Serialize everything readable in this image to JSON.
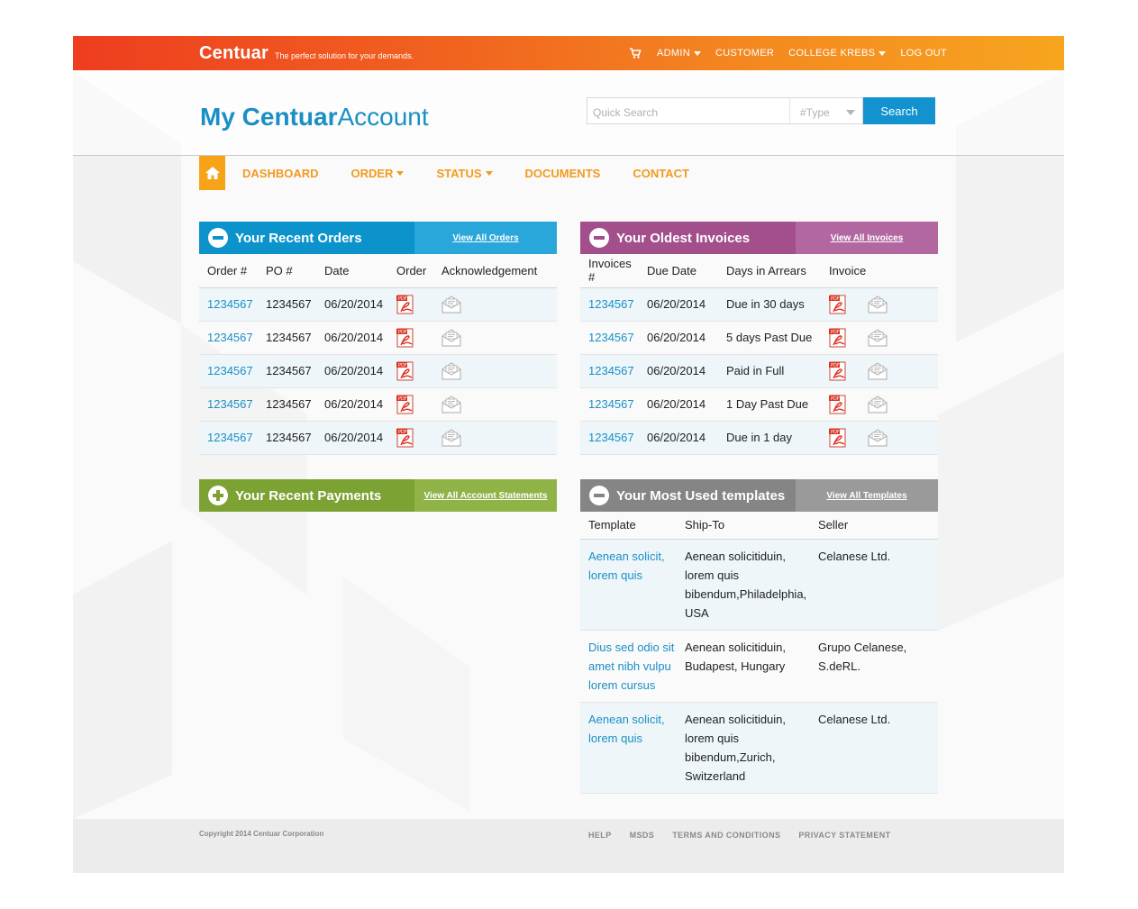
{
  "topbar": {
    "brand": "Centuar",
    "tagline": "The perfect solution for your demands.",
    "cart_icon": "cart-icon",
    "links": [
      "ADMIN",
      "CUSTOMER",
      "COLLEGE KREBS",
      "LOG OUT"
    ],
    "gradient_colors": [
      "#ee3d1f",
      "#f7a51f"
    ]
  },
  "header": {
    "title_bold": "My Centuar",
    "title_light": "Account",
    "search_placeholder": "Quick Search",
    "type_placeholder": "#Type",
    "search_button": "Search"
  },
  "nav": {
    "home_icon": "home-icon",
    "items": [
      "DASHBOARD",
      "ORDER",
      "STATUS",
      "DOCUMENTS",
      "CONTACT"
    ],
    "accent": "#f29a1e"
  },
  "orders": {
    "title": "Your Recent Orders",
    "link": "View All Orders",
    "headers": [
      "Order #",
      "PO #",
      "Date",
      "Order",
      "Acknowledgement"
    ],
    "rows": [
      {
        "order": "1234567",
        "po": "1234567",
        "date": "06/20/2014"
      },
      {
        "order": "1234567",
        "po": "1234567",
        "date": "06/20/2014"
      },
      {
        "order": "1234567",
        "po": "1234567",
        "date": "06/20/2014"
      },
      {
        "order": "1234567",
        "po": "1234567",
        "date": "06/20/2014"
      },
      {
        "order": "1234567",
        "po": "1234567",
        "date": "06/20/2014"
      }
    ]
  },
  "invoices": {
    "title": "Your Oldest Invoices",
    "link": "View All Invoices",
    "headers": [
      "Invoices #",
      "Due Date",
      "Days in Arrears",
      "Invoice"
    ],
    "rows": [
      {
        "invoice": "1234567",
        "due": "06/20/2014",
        "arrears": "Due in 30 days"
      },
      {
        "invoice": "1234567",
        "due": "06/20/2014",
        "arrears": "5 days Past Due"
      },
      {
        "invoice": "1234567",
        "due": "06/20/2014",
        "arrears": "Paid in Full"
      },
      {
        "invoice": "1234567",
        "due": "06/20/2014",
        "arrears": "1 Day Past Due"
      },
      {
        "invoice": "1234567",
        "due": "06/20/2014",
        "arrears": "Due in 1 day"
      }
    ]
  },
  "payments": {
    "title": "Your Recent Payments",
    "link": "View All Account Statements"
  },
  "templates": {
    "title": "Your Most Used templates",
    "link": "View All Templates",
    "headers": [
      "Template",
      "Ship-To",
      "Seller"
    ],
    "rows": [
      {
        "template": "Aenean solicit, lorem quis",
        "ship_to": "Aenean solicitiduin, lorem quis bibendum,Philadelphia, USA",
        "seller": "Celanese Ltd."
      },
      {
        "template": "Dius sed odio sit amet nibh vulpu lorem cursus",
        "ship_to": "Aenean solicitiduin, Budapest, Hungary",
        "seller": "Grupo Celanese, S.deRL."
      },
      {
        "template": "Aenean solicit, lorem quis",
        "ship_to": "Aenean solicitiduin, lorem quis bibendum,Zurich, Switzerland",
        "seller": "Celanese Ltd."
      }
    ]
  },
  "footer": {
    "copyright": "Copyright 2014 Centuar Corporation",
    "links": [
      "HELP",
      "MSDS",
      "TERMS AND CONDITIONS",
      "PRIVACY STATEMENT"
    ]
  }
}
